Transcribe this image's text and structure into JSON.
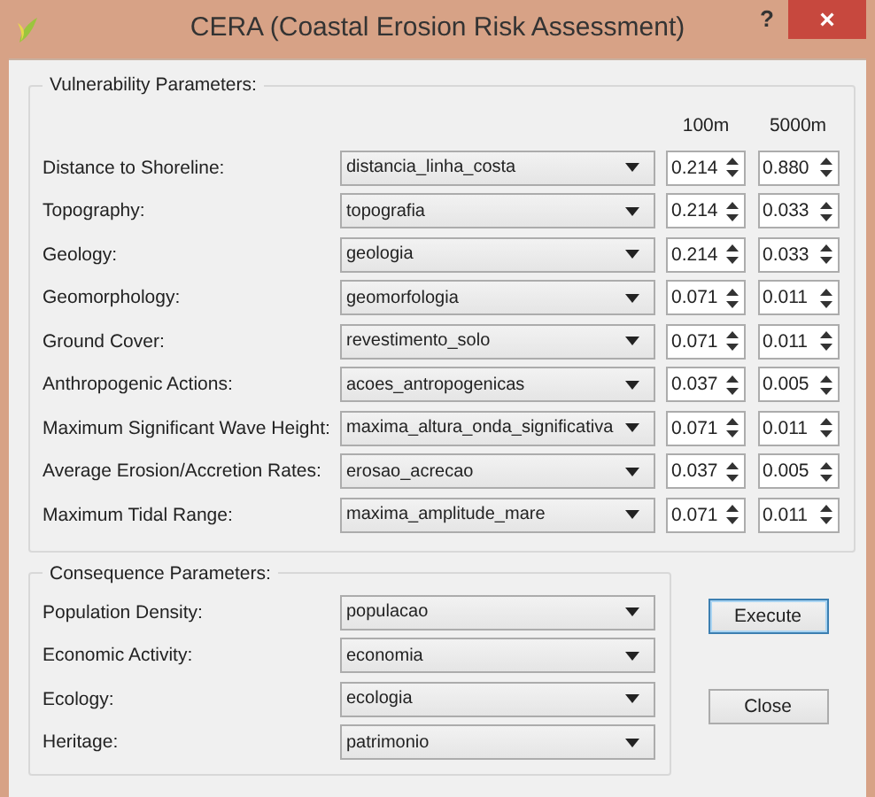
{
  "window": {
    "title": "CERA (Coastal Erosion Risk Assessment)",
    "help": "?",
    "close": "×"
  },
  "vulnerability": {
    "title": "Vulnerability Parameters:",
    "columns": [
      "100m",
      "5000m"
    ],
    "rows": [
      {
        "label": "Distance to Shoreline:",
        "layer": "distancia_linha_costa",
        "w100": "0.214",
        "w5000": "0.880"
      },
      {
        "label": "Topography:",
        "layer": "topografia",
        "w100": "0.214",
        "w5000": "0.033"
      },
      {
        "label": "Geology:",
        "layer": "geologia",
        "w100": "0.214",
        "w5000": "0.033"
      },
      {
        "label": "Geomorphology:",
        "layer": "geomorfologia",
        "w100": "0.071",
        "w5000": "0.011"
      },
      {
        "label": "Ground Cover:",
        "layer": "revestimento_solo",
        "w100": "0.071",
        "w5000": "0.011"
      },
      {
        "label": "Anthropogenic Actions:",
        "layer": "acoes_antropogenicas",
        "w100": "0.037",
        "w5000": "0.005"
      },
      {
        "label": "Maximum Significant Wave Height:",
        "layer": "maxima_altura_onda_significativa",
        "w100": "0.071",
        "w5000": "0.011"
      },
      {
        "label": "Average Erosion/Accretion Rates:",
        "layer": "erosao_acrecao",
        "w100": "0.037",
        "w5000": "0.005"
      },
      {
        "label": "Maximum Tidal Range:",
        "layer": "maxima_amplitude_mare",
        "w100": "0.071",
        "w5000": "0.011"
      }
    ]
  },
  "consequence": {
    "title": "Consequence Parameters:",
    "rows": [
      {
        "label": "Population Density:",
        "layer": "populacao"
      },
      {
        "label": "Economic Activity:",
        "layer": "economia"
      },
      {
        "label": "Ecology:",
        "layer": "ecologia"
      },
      {
        "label": "Heritage:",
        "layer": "patrimonio"
      }
    ]
  },
  "buttons": [
    {
      "label": "Execute",
      "focused": true
    },
    {
      "label": "Close",
      "focused": false
    }
  ]
}
